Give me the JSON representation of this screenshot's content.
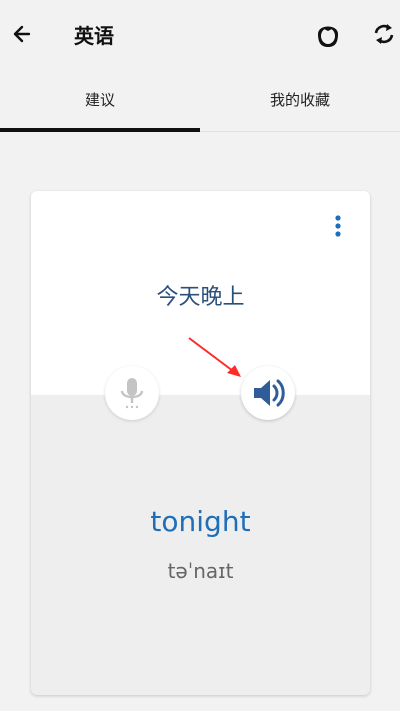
{
  "header": {
    "title": "英语",
    "icons": {
      "back": "arrow-left-icon",
      "mascot": "mascot-face-icon",
      "refresh": "refresh-icon"
    }
  },
  "tabs": [
    {
      "label": "建议",
      "selected": true
    },
    {
      "label": "我的收藏",
      "selected": false
    }
  ],
  "card": {
    "source_text": "今天晚上",
    "translation": "tonight",
    "phonetic": "təˈnaɪt",
    "icons": {
      "more": "more-vertical-icon",
      "mic": "microphone-icon",
      "speaker": "speaker-icon"
    }
  },
  "colors": {
    "accent": "#1f6eb8",
    "source_text": "#2a4f7a",
    "annotation_arrow": "#ff2a2a"
  }
}
